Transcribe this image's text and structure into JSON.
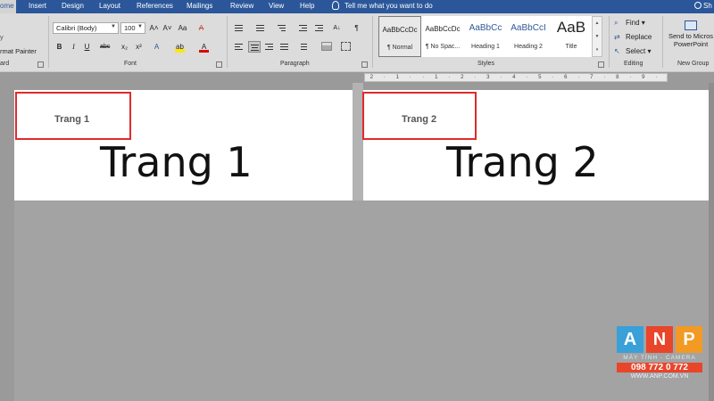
{
  "menubar": {
    "home": "ome",
    "tabs": [
      "Insert",
      "Design",
      "Layout",
      "References",
      "Mailings",
      "Review",
      "View",
      "Help"
    ],
    "tell_me": "Tell me what you want to do",
    "user": "Sh"
  },
  "ribbon": {
    "clipboard": {
      "copy": "y",
      "format_painter": "rmat Painter",
      "label": "ard"
    },
    "font": {
      "font_name": "Calibri (Body)",
      "font_size": "100",
      "grow": "A˄",
      "shrink": "A˅",
      "case": "Aa",
      "clear": "A",
      "bold": "B",
      "italic": "I",
      "underline": "U",
      "strike": "abc",
      "subscript": "x₂",
      "superscript": "x²",
      "effects": "A",
      "highlight": "ab",
      "color": "A",
      "label": "Font"
    },
    "paragraph": {
      "label": "Paragraph",
      "sort": "A↓",
      "pilcrow": "¶"
    },
    "styles": {
      "label": "Styles",
      "items": [
        {
          "sample": "AaBbCcDc",
          "name": "¶ Normal"
        },
        {
          "sample": "AaBbCcDc",
          "name": "¶ No Spac..."
        },
        {
          "sample": "AaBbCc",
          "name": "Heading 1"
        },
        {
          "sample": "AaBbCcI",
          "name": "Heading 2"
        },
        {
          "sample": "AaB",
          "name": "Title"
        }
      ]
    },
    "editing": {
      "find": "Find",
      "replace": "Replace",
      "select": "Select",
      "label": "Editing"
    },
    "share": {
      "line1": "Send to Micros",
      "line2": "PowerPoint",
      "label": "New Group"
    }
  },
  "ruler": {
    "marks": [
      "2",
      "",
      "1",
      "",
      "",
      "1",
      "",
      "2",
      "",
      "3",
      "",
      "4",
      "",
      "5",
      "",
      "6",
      "",
      "7",
      "",
      "8",
      "",
      "9",
      "",
      "10"
    ]
  },
  "pages": [
    {
      "header": "Trang 1",
      "body": "Trang 1"
    },
    {
      "header": "Trang 2",
      "body": "Trang 2"
    }
  ],
  "watermark": {
    "letters": [
      "A",
      "N",
      "P"
    ],
    "tagline": "MÁY TÍNH - CAMERA",
    "phone": "098 772 0 772",
    "site": "WWW.ANP.COM.VN"
  },
  "colors": {
    "title_bar": "#2b579a",
    "highlight_box": "#e02b2b",
    "heading_style": "#2e5a9a"
  }
}
